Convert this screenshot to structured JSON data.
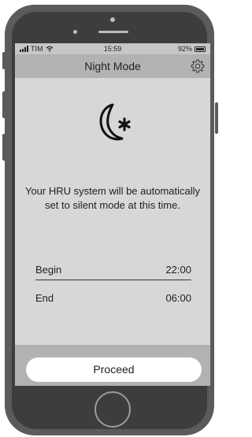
{
  "status_bar": {
    "carrier": "TIM",
    "time": "15:59",
    "battery": "92%"
  },
  "nav": {
    "title": "Night Mode"
  },
  "main": {
    "description": "Your HRU system will be automatically set to silent mode at this time.",
    "schedule": [
      {
        "label": "Begin",
        "value": "22:00"
      },
      {
        "label": "End",
        "value": "06:00"
      }
    ]
  },
  "footer": {
    "proceed_label": "Proceed"
  },
  "icons": {
    "moon": "moon-star-icon",
    "settings": "gear-icon",
    "wifi": "wifi-icon",
    "signal": "signal-icon",
    "battery": "battery-icon"
  },
  "colors": {
    "screen_bg": "#d7d7d7",
    "bar_bg": "#b2b2b2",
    "phone_body": "#5b5b5d",
    "button_bg": "#ffffff"
  }
}
